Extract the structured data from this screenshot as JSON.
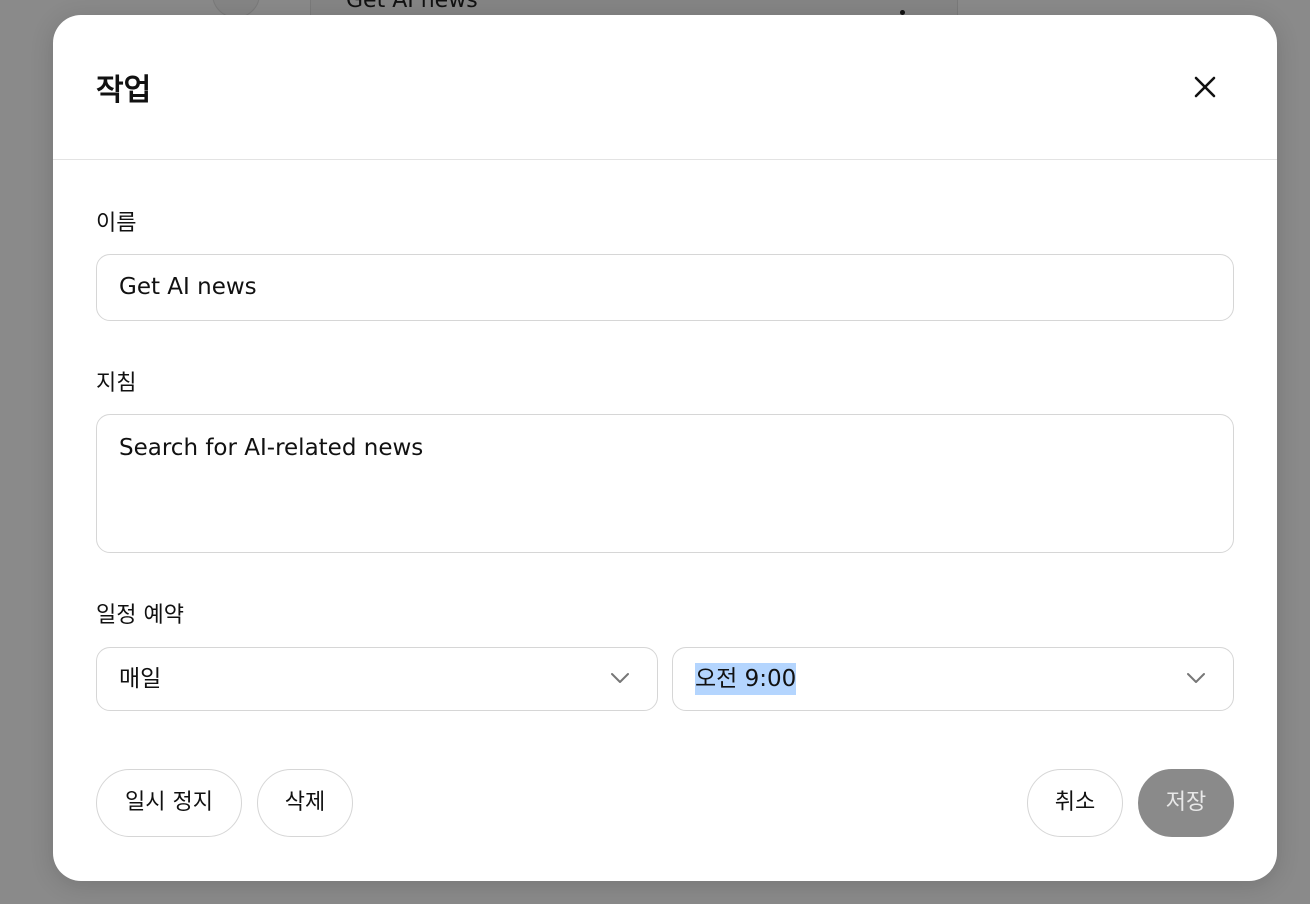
{
  "background": {
    "card_title": "Get AI news"
  },
  "dialog": {
    "title": "작업",
    "close_icon": "close-icon"
  },
  "form": {
    "name": {
      "label": "이름",
      "value": "Get AI news"
    },
    "instructions": {
      "label": "지침",
      "value": "Search for AI-related news"
    },
    "schedule": {
      "label": "일정 예약",
      "frequency": "매일",
      "time": "오전 9:00"
    }
  },
  "actions": {
    "pause_label": "일시 정지",
    "delete_label": "삭제",
    "cancel_label": "취소",
    "save_label": "저장"
  },
  "colors": {
    "overlay": "#8a8a8a",
    "save_disabled_bg": "#8a8a8a",
    "text_selection": "#b4d5fe"
  }
}
